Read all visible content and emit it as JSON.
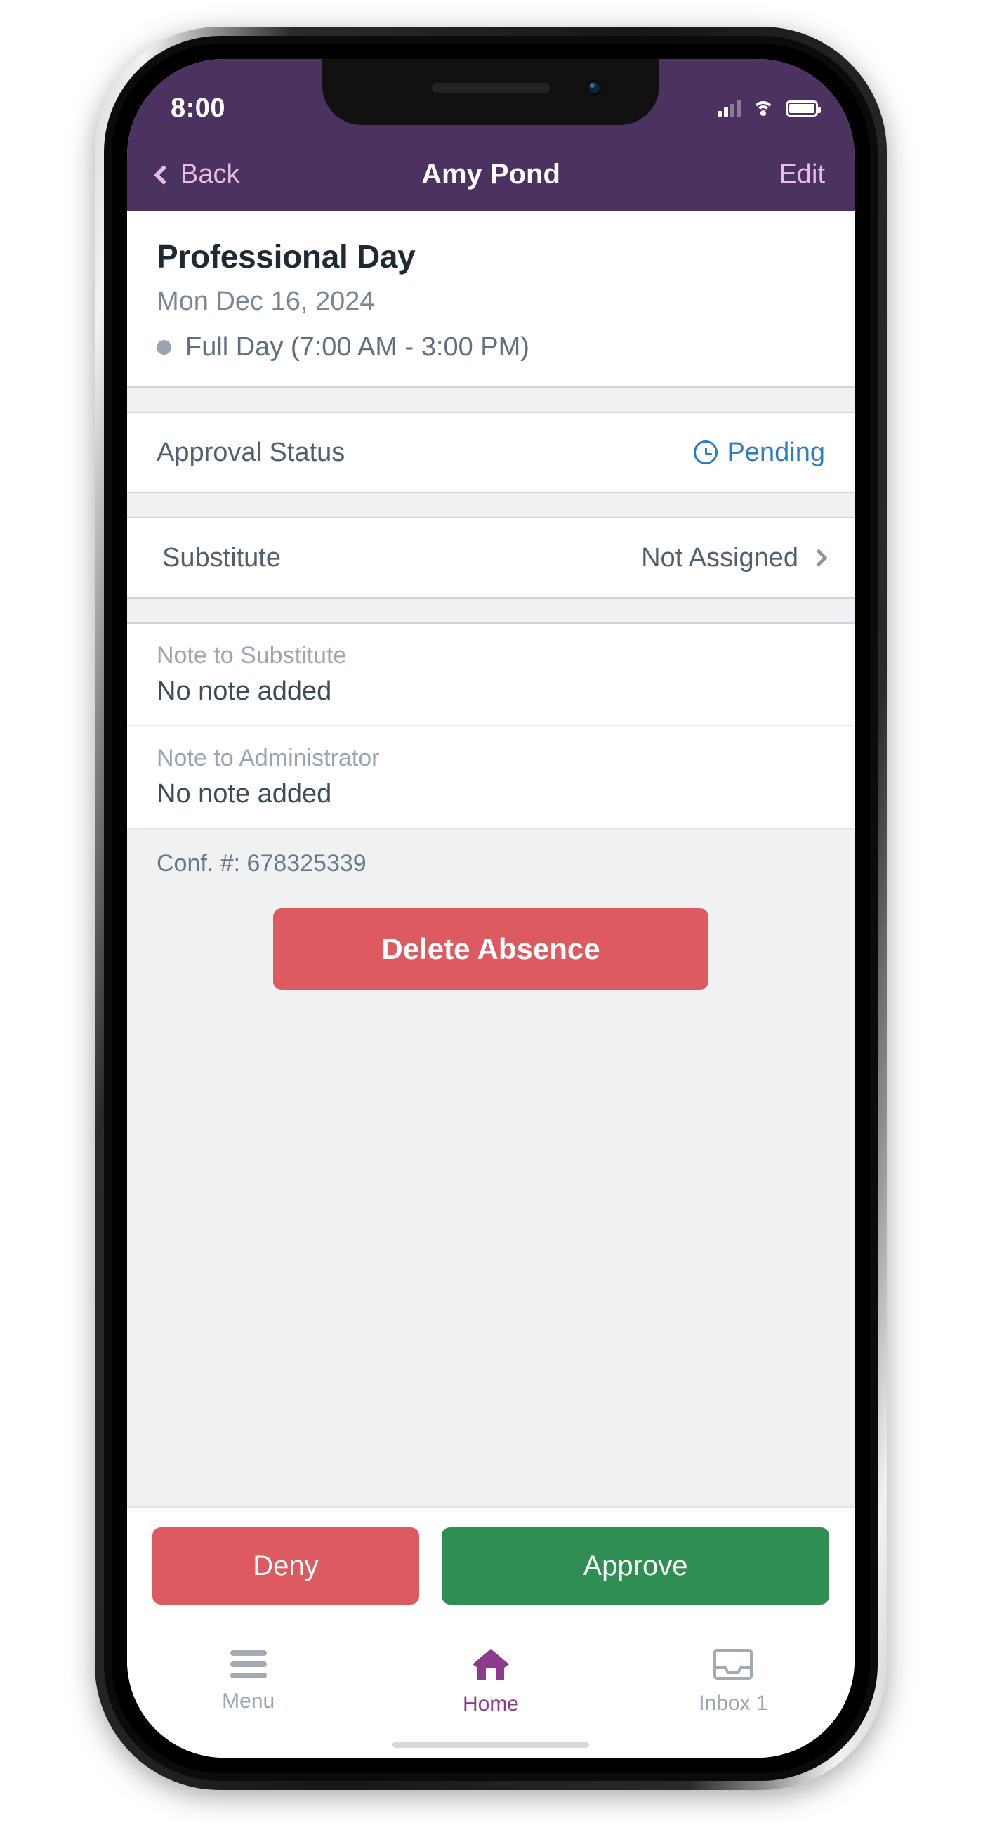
{
  "status_bar": {
    "time": "8:00",
    "signal_icon": "signal-bars-icon",
    "wifi_icon": "wifi-icon",
    "battery_icon": "battery-full-icon"
  },
  "nav": {
    "back_label": "Back",
    "back_icon": "chevron-left-icon",
    "title": "Amy Pond",
    "edit_label": "Edit"
  },
  "absence": {
    "title": "Professional Day",
    "date": "Mon Dec 16, 2024",
    "time_range": "Full Day (7:00 AM - 3:00 PM)",
    "time_dot_icon": "status-dot-icon"
  },
  "approval": {
    "label": "Approval Status",
    "value": "Pending",
    "icon": "clock-icon",
    "color": "#2b7cc4"
  },
  "substitute": {
    "label": "Substitute",
    "value": "Not Assigned",
    "chevron_icon": "chevron-right-icon"
  },
  "notes": [
    {
      "label": "Note to Substitute",
      "value": "No note added"
    },
    {
      "label": "Note to Administrator",
      "value": "No note added"
    }
  ],
  "footer": {
    "confirmation": "Conf. #: 678325339",
    "delete_label": "Delete Absence",
    "delete_color": "#dd5a61"
  },
  "actions": {
    "deny_label": "Deny",
    "deny_color": "#dd5a61",
    "approve_label": "Approve",
    "approve_color": "#2f8f52"
  },
  "tabbar": {
    "items": [
      {
        "label": "Menu",
        "icon": "hamburger-menu-icon",
        "active": false
      },
      {
        "label": "Home",
        "icon": "home-icon",
        "active": true
      },
      {
        "label": "Inbox 1",
        "icon": "inbox-tray-icon",
        "active": false
      }
    ],
    "active_color": "#8b3a8e"
  },
  "theme": {
    "header_purple": "#4b3260",
    "accent_pink": "#e8bbe8"
  }
}
